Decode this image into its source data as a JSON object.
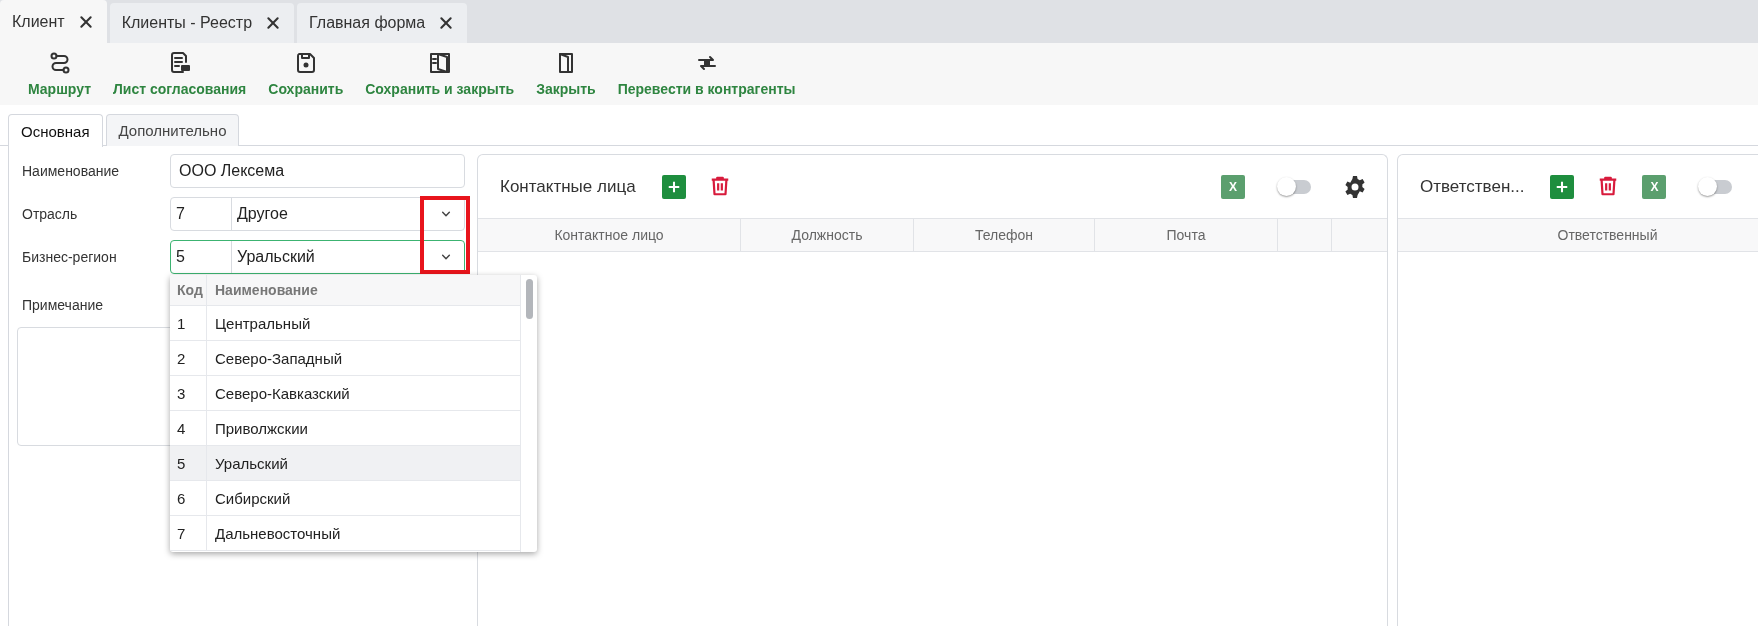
{
  "doc_tabs": [
    {
      "label": "Клиент",
      "selected": true
    },
    {
      "label": "Клиенты - Реестр",
      "selected": false
    },
    {
      "label": "Главная форма",
      "selected": false
    }
  ],
  "toolbar": [
    {
      "label": "Маршрут"
    },
    {
      "label": "Лист согласования"
    },
    {
      "label": "Сохранить"
    },
    {
      "label": "Сохранить и закрыть"
    },
    {
      "label": "Закрыть"
    },
    {
      "label": "Перевести в контрагенты"
    }
  ],
  "form_tabs": [
    {
      "label": "Основная",
      "selected": true
    },
    {
      "label": "Дополнительно",
      "selected": false
    }
  ],
  "fields": [
    {
      "kind": "text",
      "label": "Наименование",
      "value": "ООО Лексема"
    },
    {
      "kind": "lookup",
      "label": "Отрасль",
      "code": "7",
      "value": "Другое",
      "focused": false
    },
    {
      "kind": "lookup",
      "label": "Бизнес-регион",
      "code": "5",
      "value": "Уральский",
      "focused": true
    },
    {
      "kind": "textarea",
      "label": "Примечание"
    }
  ],
  "dropdown": {
    "columns": [
      "Код",
      "Наименование"
    ],
    "rows": [
      {
        "code": "1",
        "name": "Центральный",
        "selected": false
      },
      {
        "code": "2",
        "name": "Северо-Западный",
        "selected": false
      },
      {
        "code": "3",
        "name": "Северо-Кавказский",
        "selected": false
      },
      {
        "code": "4",
        "name": "Приволжскии",
        "selected": false
      },
      {
        "code": "5",
        "name": "Уральский",
        "selected": true
      },
      {
        "code": "6",
        "name": "Сибирский",
        "selected": false
      },
      {
        "code": "7",
        "name": "Дальневосточный",
        "selected": false
      }
    ]
  },
  "panels": [
    {
      "title": "Контактные лица",
      "actions": [
        {
          "kind": "add"
        },
        {
          "kind": "delete"
        }
      ],
      "tools": [
        {
          "kind": "excel",
          "label": "X"
        },
        {
          "kind": "toggle",
          "on": false
        },
        {
          "kind": "settings"
        }
      ],
      "columns": [
        "Контактное лицо",
        "Должность",
        "Телефон",
        "Почта"
      ]
    },
    {
      "title": "Ответствен...",
      "actions": [
        {
          "kind": "add"
        },
        {
          "kind": "delete"
        },
        {
          "kind": "excel",
          "label": "X"
        },
        {
          "kind": "toggle",
          "on": false
        }
      ],
      "columns": [
        "Ответственный"
      ]
    }
  ]
}
